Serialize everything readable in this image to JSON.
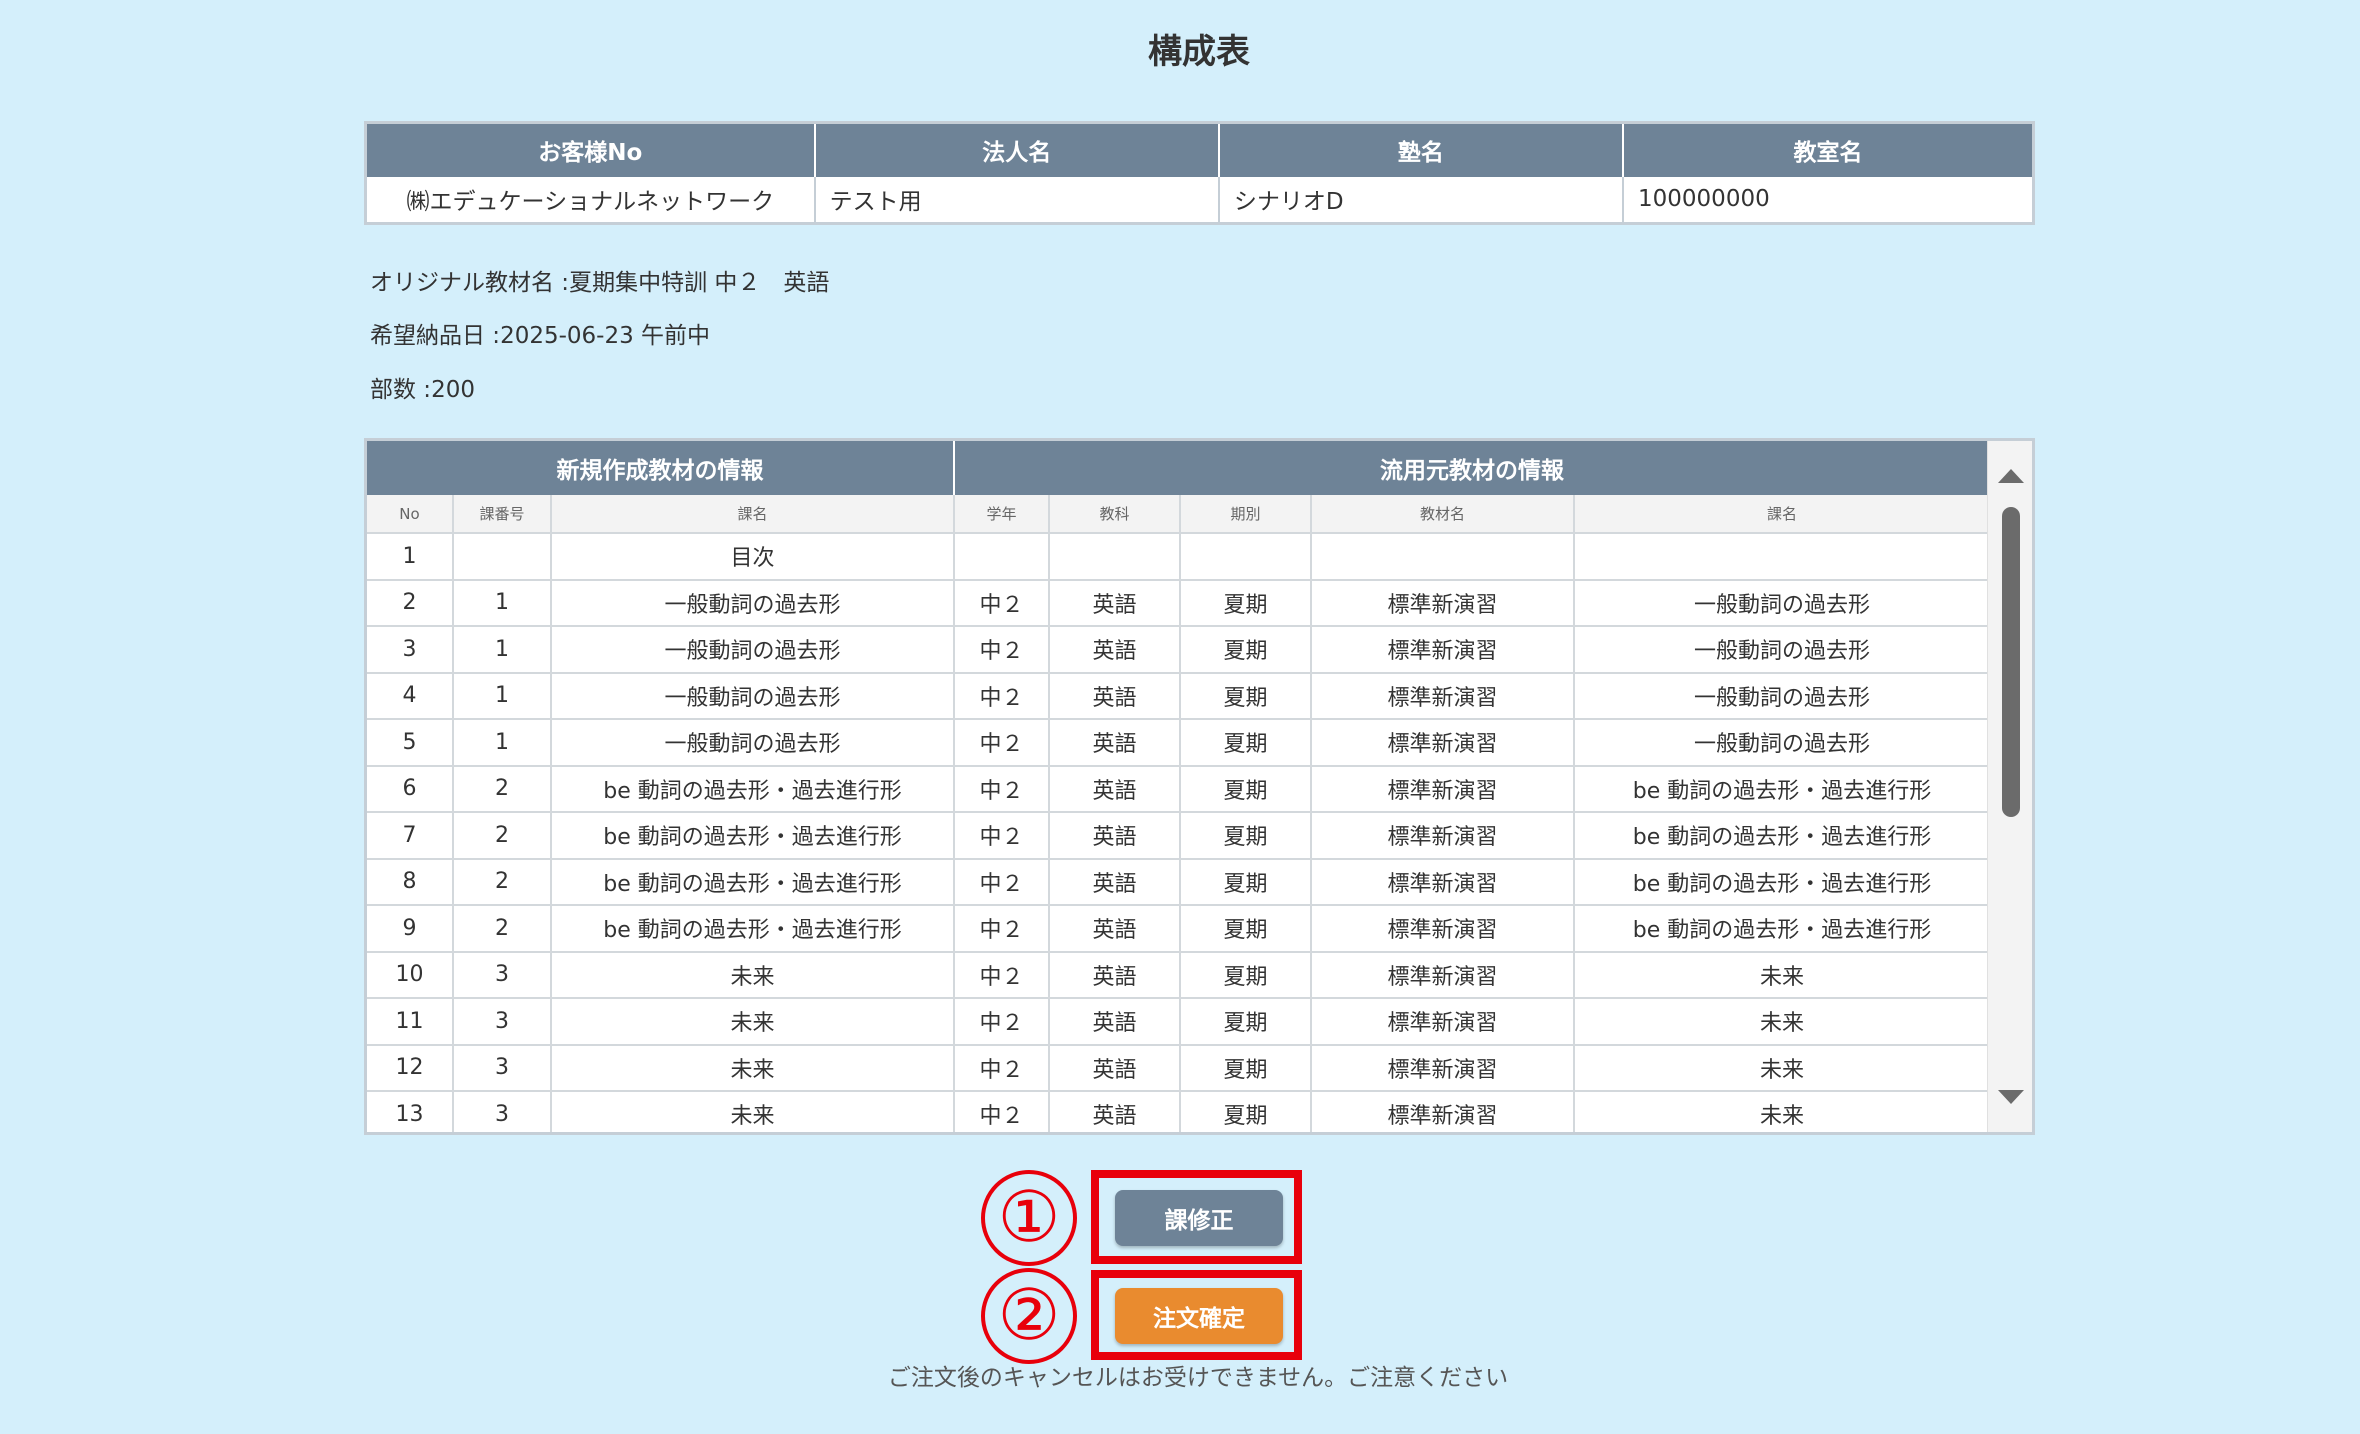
{
  "page": {
    "title": "構成表"
  },
  "customer": {
    "headers": [
      "お客様No",
      "法人名",
      "塾名",
      "教室名"
    ],
    "values": [
      "㈱エデュケーショナルネットワーク",
      "テスト用",
      "シナリオD",
      "100000000"
    ]
  },
  "info": {
    "material_label": "オリジナル教材名 :",
    "material_value": "夏期集中特訓 中２　英語",
    "delivery_label": "希望納品日 :",
    "delivery_value": "2025-06-23 午前中",
    "copies_label": "部数 :",
    "copies_value": "200"
  },
  "composition": {
    "group_new": "新規作成教材の情報",
    "group_source": "流用元教材の情報",
    "sub_headers": [
      "No",
      "課番号",
      "課名",
      "学年",
      "教科",
      "期別",
      "教材名",
      "課名"
    ],
    "rows": [
      [
        "1",
        "",
        "目次",
        "",
        "",
        "",
        "",
        ""
      ],
      [
        "2",
        "1",
        "一般動詞の過去形",
        "中２",
        "英語",
        "夏期",
        "標準新演習",
        "一般動詞の過去形"
      ],
      [
        "3",
        "1",
        "一般動詞の過去形",
        "中２",
        "英語",
        "夏期",
        "標準新演習",
        "一般動詞の過去形"
      ],
      [
        "4",
        "1",
        "一般動詞の過去形",
        "中２",
        "英語",
        "夏期",
        "標準新演習",
        "一般動詞の過去形"
      ],
      [
        "5",
        "1",
        "一般動詞の過去形",
        "中２",
        "英語",
        "夏期",
        "標準新演習",
        "一般動詞の過去形"
      ],
      [
        "6",
        "2",
        "be 動詞の過去形・過去進行形",
        "中２",
        "英語",
        "夏期",
        "標準新演習",
        "be 動詞の過去形・過去進行形"
      ],
      [
        "7",
        "2",
        "be 動詞の過去形・過去進行形",
        "中２",
        "英語",
        "夏期",
        "標準新演習",
        "be 動詞の過去形・過去進行形"
      ],
      [
        "8",
        "2",
        "be 動詞の過去形・過去進行形",
        "中２",
        "英語",
        "夏期",
        "標準新演習",
        "be 動詞の過去形・過去進行形"
      ],
      [
        "9",
        "2",
        "be 動詞の過去形・過去進行形",
        "中２",
        "英語",
        "夏期",
        "標準新演習",
        "be 動詞の過去形・過去進行形"
      ],
      [
        "10",
        "3",
        "未来",
        "中２",
        "英語",
        "夏期",
        "標準新演習",
        "未来"
      ],
      [
        "11",
        "3",
        "未来",
        "中２",
        "英語",
        "夏期",
        "標準新演習",
        "未来"
      ],
      [
        "12",
        "3",
        "未来",
        "中２",
        "英語",
        "夏期",
        "標準新演習",
        "未来"
      ],
      [
        "13",
        "3",
        "未来",
        "中２",
        "英語",
        "夏期",
        "標準新演習",
        "未来"
      ]
    ]
  },
  "actions": {
    "marker_1": "①",
    "marker_2": "②",
    "edit_label": "課修正",
    "confirm_label": "注文確定",
    "notice": "ご注文後のキャンセルはお受けできません。ご注意ください"
  },
  "colors": {
    "background": "#d4effb",
    "header": "#6e8397",
    "edit_button": "#6e8397",
    "confirm_button": "#e98b2f",
    "highlight": "#e8000b"
  }
}
